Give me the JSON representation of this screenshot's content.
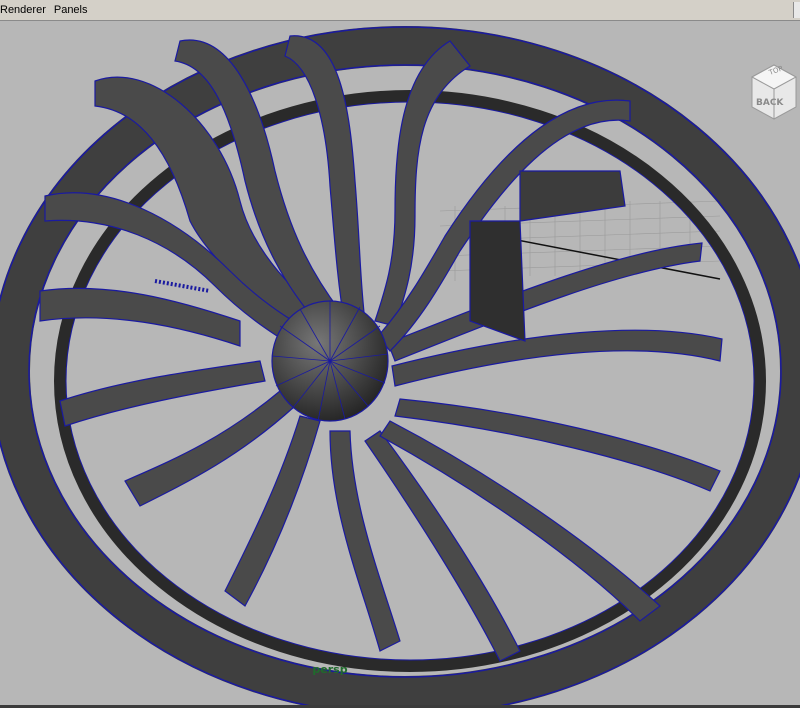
{
  "menubar": {
    "items": [
      {
        "label": "Renderer"
      },
      {
        "label": "Panels"
      }
    ]
  },
  "viewport": {
    "camera_label": "persp",
    "view_cube_label": "BACK",
    "view_cube_side_label": "TOP"
  },
  "colors": {
    "viewport_bg": "#b7b7b7",
    "wireframe": "#1a1aa0",
    "shading": "#4a4a4a",
    "camera_label": "#1f6b2c",
    "grid": "#8a8a8a"
  }
}
